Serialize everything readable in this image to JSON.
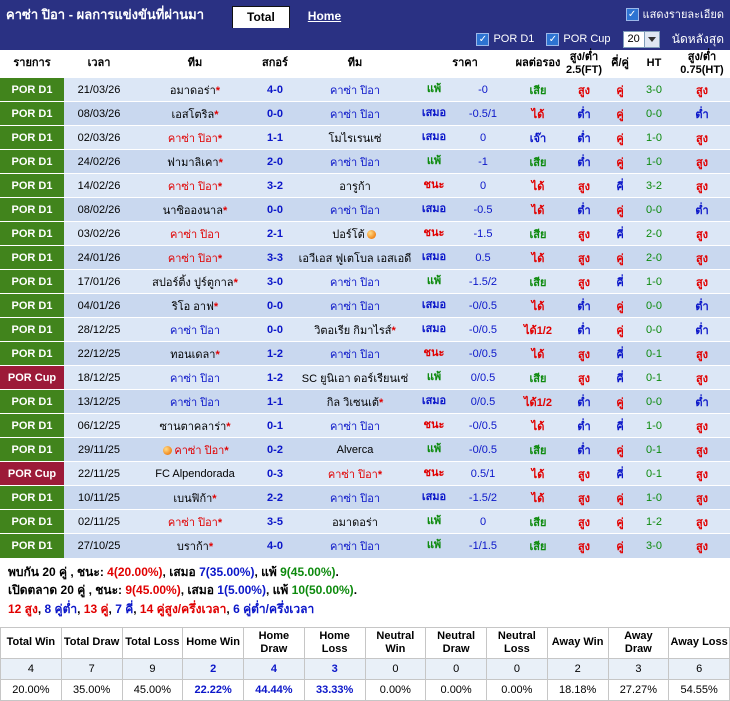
{
  "header": {
    "title": "คาซ่า ปิอา - ผลการแข่งขันที่ผ่านมา",
    "tabs": [
      {
        "label": "Total",
        "active": true
      },
      {
        "label": "Home",
        "active": false
      }
    ],
    "show_details_label": "แสดงรายละเอียด"
  },
  "filter_bar": {
    "leagues": [
      {
        "label": "POR D1",
        "checked": true
      },
      {
        "label": "POR Cup",
        "checked": true
      }
    ],
    "match_count_value": "20",
    "last_matches_label": "นัดหลังสุด"
  },
  "table": {
    "headers": {
      "league": "รายการ",
      "date": "เวลา",
      "home": "ทีม",
      "score": "สกอร์",
      "away": "ทีม",
      "price": "ราคา",
      "handicap": "ผลต่อรอง",
      "ou_ft": "สูง/ต่ำ 2.5(FT)",
      "odd_even": "คี่/คู่",
      "ht": "HT",
      "ou_ht": "สูง/ต่ำ 0.75(HT)"
    },
    "rows": [
      {
        "league": "POR D1",
        "cup": false,
        "date": "21/03/26",
        "home": {
          "name": "อมาดอร่า",
          "c": "black",
          "star": true,
          "icon": null
        },
        "score": "4-0",
        "away": {
          "name": "คาซ่า ปิอา",
          "c": "blue",
          "star": false,
          "icon": null
        },
        "result": "แพ้",
        "result_c": "green",
        "price": "-0",
        "handicap": "เสีย",
        "handicap_c": "green",
        "ou_ft": "สูง",
        "ou_ft_c": "red",
        "oe": "คู่",
        "oe_c": "red",
        "ht": "3-0",
        "ou_ht": "สูง",
        "ou_ht_c": "red"
      },
      {
        "league": "POR D1",
        "cup": false,
        "date": "08/03/26",
        "home": {
          "name": "เอสโตริล",
          "c": "black",
          "star": true,
          "icon": null
        },
        "score": "0-0",
        "away": {
          "name": "คาซ่า ปิอา",
          "c": "blue",
          "star": false,
          "icon": null
        },
        "result": "เสมอ",
        "result_c": "blue",
        "price": "-0.5/1",
        "handicap": "ได้",
        "handicap_c": "red",
        "ou_ft": "ต่ำ",
        "ou_ft_c": "blue",
        "oe": "คู่",
        "oe_c": "red",
        "ht": "0-0",
        "ou_ht": "ต่ำ",
        "ou_ht_c": "blue"
      },
      {
        "league": "POR D1",
        "cup": false,
        "date": "02/03/26",
        "home": {
          "name": "คาซ่า ปิอา",
          "c": "red",
          "star": true,
          "icon": null
        },
        "score": "1-1",
        "away": {
          "name": "โมไรเรนเซ่",
          "c": "black",
          "star": false,
          "icon": null
        },
        "result": "เสมอ",
        "result_c": "blue",
        "price": "0",
        "handicap": "เจ๊า",
        "handicap_c": "blue",
        "ou_ft": "ต่ำ",
        "ou_ft_c": "blue",
        "oe": "คู่",
        "oe_c": "red",
        "ht": "1-0",
        "ou_ht": "สูง",
        "ou_ht_c": "red"
      },
      {
        "league": "POR D1",
        "cup": false,
        "date": "24/02/26",
        "home": {
          "name": "ฟามาลิเคา",
          "c": "black",
          "star": true,
          "icon": null
        },
        "score": "2-0",
        "away": {
          "name": "คาซ่า ปิอา",
          "c": "blue",
          "star": false,
          "icon": null
        },
        "result": "แพ้",
        "result_c": "green",
        "price": "-1",
        "handicap": "เสีย",
        "handicap_c": "green",
        "ou_ft": "ต่ำ",
        "ou_ft_c": "blue",
        "oe": "คู่",
        "oe_c": "red",
        "ht": "1-0",
        "ou_ht": "สูง",
        "ou_ht_c": "red"
      },
      {
        "league": "POR D1",
        "cup": false,
        "date": "14/02/26",
        "home": {
          "name": "คาซ่า ปิอา",
          "c": "red",
          "star": true,
          "icon": null
        },
        "score": "3-2",
        "away": {
          "name": "อารูก้า",
          "c": "black",
          "star": false,
          "icon": null
        },
        "result": "ชนะ",
        "result_c": "red",
        "price": "0",
        "handicap": "ได้",
        "handicap_c": "red",
        "ou_ft": "สูง",
        "ou_ft_c": "red",
        "oe": "คี่",
        "oe_c": "blue",
        "ht": "3-2",
        "ou_ht": "สูง",
        "ou_ht_c": "red"
      },
      {
        "league": "POR D1",
        "cup": false,
        "date": "08/02/26",
        "home": {
          "name": "นาซิอองนาล",
          "c": "black",
          "star": true,
          "icon": null
        },
        "score": "0-0",
        "away": {
          "name": "คาซ่า ปิอา",
          "c": "blue",
          "star": false,
          "icon": null
        },
        "result": "เสมอ",
        "result_c": "blue",
        "price": "-0.5",
        "handicap": "ได้",
        "handicap_c": "red",
        "ou_ft": "ต่ำ",
        "ou_ft_c": "blue",
        "oe": "คู่",
        "oe_c": "red",
        "ht": "0-0",
        "ou_ht": "ต่ำ",
        "ou_ht_c": "blue"
      },
      {
        "league": "POR D1",
        "cup": false,
        "date": "03/02/26",
        "home": {
          "name": "คาซ่า ปิอา",
          "c": "red",
          "star": false,
          "icon": null
        },
        "score": "2-1",
        "away": {
          "name": "ปอร์โต้",
          "c": "black",
          "star": false,
          "icon": "after"
        },
        "result": "ชนะ",
        "result_c": "red",
        "price": "-1.5",
        "handicap": "เสีย",
        "handicap_c": "green",
        "ou_ft": "สูง",
        "ou_ft_c": "red",
        "oe": "คี่",
        "oe_c": "blue",
        "ht": "2-0",
        "ou_ht": "สูง",
        "ou_ht_c": "red"
      },
      {
        "league": "POR D1",
        "cup": false,
        "date": "24/01/26",
        "home": {
          "name": "คาซ่า ปิอา",
          "c": "red",
          "star": true,
          "icon": null
        },
        "score": "3-3",
        "away": {
          "name": "เอวีเอส ฟูเตโบล เอสเอดี",
          "c": "black",
          "star": false,
          "icon": null
        },
        "result": "เสมอ",
        "result_c": "blue",
        "price": "0.5",
        "handicap": "ได้",
        "handicap_c": "red",
        "ou_ft": "สูง",
        "ou_ft_c": "red",
        "oe": "คู่",
        "oe_c": "red",
        "ht": "2-0",
        "ou_ht": "สูง",
        "ou_ht_c": "red"
      },
      {
        "league": "POR D1",
        "cup": false,
        "date": "17/01/26",
        "home": {
          "name": "สปอร์ติ้ง ปูร์ตูกาล",
          "c": "black",
          "star": true,
          "icon": null
        },
        "score": "3-0",
        "away": {
          "name": "คาซ่า ปิอา",
          "c": "blue",
          "star": false,
          "icon": null
        },
        "result": "แพ้",
        "result_c": "green",
        "price": "-1.5/2",
        "handicap": "เสีย",
        "handicap_c": "green",
        "ou_ft": "สูง",
        "ou_ft_c": "red",
        "oe": "คี่",
        "oe_c": "blue",
        "ht": "1-0",
        "ou_ht": "สูง",
        "ou_ht_c": "red"
      },
      {
        "league": "POR D1",
        "cup": false,
        "date": "04/01/26",
        "home": {
          "name": "ริโอ อาฟ",
          "c": "black",
          "star": true,
          "icon": null
        },
        "score": "0-0",
        "away": {
          "name": "คาซ่า ปิอา",
          "c": "blue",
          "star": false,
          "icon": null
        },
        "result": "เสมอ",
        "result_c": "blue",
        "price": "-0/0.5",
        "handicap": "ได้",
        "handicap_c": "red",
        "ou_ft": "ต่ำ",
        "ou_ft_c": "blue",
        "oe": "คู่",
        "oe_c": "red",
        "ht": "0-0",
        "ou_ht": "ต่ำ",
        "ou_ht_c": "blue"
      },
      {
        "league": "POR D1",
        "cup": false,
        "date": "28/12/25",
        "home": {
          "name": "คาซ่า ปิอา",
          "c": "blue",
          "star": false,
          "icon": null
        },
        "score": "0-0",
        "away": {
          "name": "วิตอเรีย กิมาไรส์",
          "c": "black",
          "star": true,
          "icon": null
        },
        "result": "เสมอ",
        "result_c": "blue",
        "price": "-0/0.5",
        "handicap": "ได้1/2",
        "handicap_c": "red",
        "ou_ft": "ต่ำ",
        "ou_ft_c": "blue",
        "oe": "คู่",
        "oe_c": "red",
        "ht": "0-0",
        "ou_ht": "ต่ำ",
        "ou_ht_c": "blue"
      },
      {
        "league": "POR D1",
        "cup": false,
        "date": "22/12/25",
        "home": {
          "name": "ทอนเดลา",
          "c": "black",
          "star": true,
          "icon": null
        },
        "score": "1-2",
        "away": {
          "name": "คาซ่า ปิอา",
          "c": "blue",
          "star": false,
          "icon": null
        },
        "result": "ชนะ",
        "result_c": "red",
        "price": "-0/0.5",
        "handicap": "ได้",
        "handicap_c": "red",
        "ou_ft": "สูง",
        "ou_ft_c": "red",
        "oe": "คี่",
        "oe_c": "blue",
        "ht": "0-1",
        "ou_ht": "สูง",
        "ou_ht_c": "red"
      },
      {
        "league": "POR Cup",
        "cup": true,
        "date": "18/12/25",
        "home": {
          "name": "คาซ่า ปิอา",
          "c": "blue",
          "star": false,
          "icon": null
        },
        "score": "1-2",
        "away": {
          "name": "SC ยูนิเอา ดอร์เรียนเซ่",
          "c": "black",
          "star": false,
          "icon": null
        },
        "result": "แพ้",
        "result_c": "green",
        "price": "0/0.5",
        "handicap": "เสีย",
        "handicap_c": "green",
        "ou_ft": "สูง",
        "ou_ft_c": "red",
        "oe": "คี่",
        "oe_c": "blue",
        "ht": "0-1",
        "ou_ht": "สูง",
        "ou_ht_c": "red"
      },
      {
        "league": "POR D1",
        "cup": false,
        "date": "13/12/25",
        "home": {
          "name": "คาซ่า ปิอา",
          "c": "blue",
          "star": false,
          "icon": null
        },
        "score": "1-1",
        "away": {
          "name": "กิล วิเซนเต้",
          "c": "black",
          "star": true,
          "icon": null
        },
        "result": "เสมอ",
        "result_c": "blue",
        "price": "0/0.5",
        "handicap": "ได้1/2",
        "handicap_c": "red",
        "ou_ft": "ต่ำ",
        "ou_ft_c": "blue",
        "oe": "คู่",
        "oe_c": "red",
        "ht": "0-0",
        "ou_ht": "ต่ำ",
        "ou_ht_c": "blue"
      },
      {
        "league": "POR D1",
        "cup": false,
        "date": "06/12/25",
        "home": {
          "name": "ซานตาคลาร่า",
          "c": "black",
          "star": true,
          "icon": null
        },
        "score": "0-1",
        "away": {
          "name": "คาซ่า ปิอา",
          "c": "blue",
          "star": false,
          "icon": null
        },
        "result": "ชนะ",
        "result_c": "red",
        "price": "-0/0.5",
        "handicap": "ได้",
        "handicap_c": "red",
        "ou_ft": "ต่ำ",
        "ou_ft_c": "blue",
        "oe": "คี่",
        "oe_c": "blue",
        "ht": "1-0",
        "ou_ht": "สูง",
        "ou_ht_c": "red"
      },
      {
        "league": "POR D1",
        "cup": false,
        "date": "29/11/25",
        "home": {
          "name": "คาซ่า ปิอา",
          "c": "red",
          "star": true,
          "icon": "before"
        },
        "score": "0-2",
        "away": {
          "name": "Alverca",
          "c": "black",
          "star": false,
          "icon": null
        },
        "result": "แพ้",
        "result_c": "green",
        "price": "-0/0.5",
        "handicap": "เสีย",
        "handicap_c": "green",
        "ou_ft": "ต่ำ",
        "ou_ft_c": "blue",
        "oe": "คู่",
        "oe_c": "red",
        "ht": "0-1",
        "ou_ht": "สูง",
        "ou_ht_c": "red"
      },
      {
        "league": "POR Cup",
        "cup": true,
        "date": "22/11/25",
        "home": {
          "name": "FC Alpendorada",
          "c": "black",
          "star": false,
          "icon": null
        },
        "score": "0-3",
        "away": {
          "name": "คาซ่า ปิอา",
          "c": "red",
          "star": true,
          "icon": null
        },
        "result": "ชนะ",
        "result_c": "red",
        "price": "0.5/1",
        "handicap": "ได้",
        "handicap_c": "red",
        "ou_ft": "สูง",
        "ou_ft_c": "red",
        "oe": "คี่",
        "oe_c": "blue",
        "ht": "0-1",
        "ou_ht": "สูง",
        "ou_ht_c": "red"
      },
      {
        "league": "POR D1",
        "cup": false,
        "date": "10/11/25",
        "home": {
          "name": "เบนฟิก้า",
          "c": "black",
          "star": true,
          "icon": null
        },
        "score": "2-2",
        "away": {
          "name": "คาซ่า ปิอา",
          "c": "blue",
          "star": false,
          "icon": null
        },
        "result": "เสมอ",
        "result_c": "blue",
        "price": "-1.5/2",
        "handicap": "ได้",
        "handicap_c": "red",
        "ou_ft": "สูง",
        "ou_ft_c": "red",
        "oe": "คู่",
        "oe_c": "red",
        "ht": "1-0",
        "ou_ht": "สูง",
        "ou_ht_c": "red"
      },
      {
        "league": "POR D1",
        "cup": false,
        "date": "02/11/25",
        "home": {
          "name": "คาซ่า ปิอา",
          "c": "red",
          "star": true,
          "icon": null
        },
        "score": "3-5",
        "away": {
          "name": "อมาดอร่า",
          "c": "black",
          "star": false,
          "icon": null
        },
        "result": "แพ้",
        "result_c": "green",
        "price": "0",
        "handicap": "เสีย",
        "handicap_c": "green",
        "ou_ft": "สูง",
        "ou_ft_c": "red",
        "oe": "คู่",
        "oe_c": "red",
        "ht": "1-2",
        "ou_ht": "สูง",
        "ou_ht_c": "red"
      },
      {
        "league": "POR D1",
        "cup": false,
        "date": "27/10/25",
        "home": {
          "name": "บราก้า",
          "c": "black",
          "star": true,
          "icon": null
        },
        "score": "4-0",
        "away": {
          "name": "คาซ่า ปิอา",
          "c": "blue",
          "star": false,
          "icon": null
        },
        "result": "แพ้",
        "result_c": "green",
        "price": "-1/1.5",
        "handicap": "เสีย",
        "handicap_c": "green",
        "ou_ft": "สูง",
        "ou_ft_c": "red",
        "oe": "คู่",
        "oe_c": "red",
        "ht": "3-0",
        "ou_ht": "สูง",
        "ou_ht_c": "red"
      }
    ]
  },
  "summary": {
    "lines": [
      {
        "name": "head-to-head-summary",
        "segments": [
          {
            "t": "พบกัน 20 คู่ , ชนะ: ",
            "c": "black"
          },
          {
            "t": "4(20.00%)",
            "c": "red"
          },
          {
            "t": ", เสมอ ",
            "c": "black"
          },
          {
            "t": "7(35.00%)",
            "c": "blue"
          },
          {
            "t": ", แพ้ ",
            "c": "black"
          },
          {
            "t": "9(45.00%)",
            "c": "green"
          },
          {
            "t": ".",
            "c": "black"
          }
        ]
      },
      {
        "name": "handicap-summary",
        "segments": [
          {
            "t": "เปิดตลาด 20 คู่ , ชนะ: ",
            "c": "black"
          },
          {
            "t": "9(45.00%)",
            "c": "red"
          },
          {
            "t": ", เสมอ ",
            "c": "black"
          },
          {
            "t": "1(5.00%)",
            "c": "blue"
          },
          {
            "t": ", แพ้ ",
            "c": "black"
          },
          {
            "t": "10(50.00%)",
            "c": "green"
          },
          {
            "t": ".",
            "c": "black"
          }
        ]
      },
      {
        "name": "over-under-summary",
        "segments": [
          {
            "t": "12 สูง",
            "c": "red"
          },
          {
            "t": ", ",
            "c": "black"
          },
          {
            "t": "8 คู่ต่ำ",
            "c": "blue"
          },
          {
            "t": ", ",
            "c": "black"
          },
          {
            "t": "13 คู่",
            "c": "red"
          },
          {
            "t": ", ",
            "c": "black"
          },
          {
            "t": "7 คี่",
            "c": "blue"
          },
          {
            "t": ", ",
            "c": "black"
          },
          {
            "t": "14 คู่สูง/ครึ่งเวลา",
            "c": "red"
          },
          {
            "t": ", ",
            "c": "black"
          },
          {
            "t": "6 คู่ต่ำ/ครึ่งเวลา",
            "c": "blue"
          }
        ]
      }
    ]
  },
  "stats_table": {
    "headers": [
      "Total Win",
      "Total Draw",
      "Total Loss",
      "Home Win",
      "Home Draw",
      "Home Loss",
      "Neutral Win",
      "Neutral Draw",
      "Neutral Loss",
      "Away Win",
      "Away Draw",
      "Away Loss"
    ],
    "counts": [
      "4",
      "7",
      "9",
      "2",
      "4",
      "3",
      "0",
      "0",
      "0",
      "2",
      "3",
      "6"
    ],
    "percents": [
      "20.00%",
      "35.00%",
      "45.00%",
      "22.22%",
      "44.44%",
      "33.33%",
      "0.00%",
      "0.00%",
      "0.00%",
      "18.18%",
      "27.27%",
      "54.55%"
    ],
    "highlight_indexes": [
      3,
      4,
      5
    ]
  },
  "colors": {
    "navy": "#2a3183",
    "league_d1": "#41841c",
    "league_cup": "#9c1a38",
    "win": "#e10000",
    "draw": "#0b16c9",
    "loss": "#0d8a0d"
  }
}
